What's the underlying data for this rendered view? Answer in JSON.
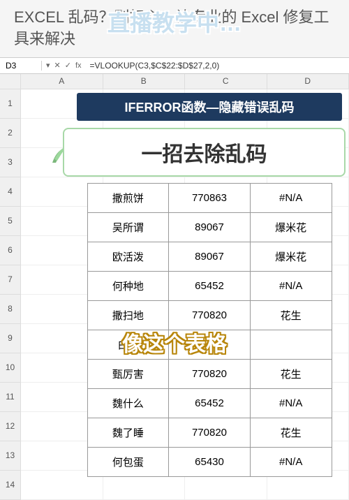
{
  "title": "EXCEL 乱码？别担心，让专业的 Excel 修复工具来解决",
  "overlay_title": "直播教学中…",
  "formula_bar": {
    "cell_ref": "D3",
    "fx_label": "fx",
    "formula": "=VLOOKUP(C3,$C$22:$D$27,2,0)"
  },
  "columns": [
    "A",
    "B",
    "C",
    "D"
  ],
  "row_numbers": [
    "1",
    "2",
    "3",
    "4",
    "5",
    "6",
    "7",
    "8",
    "9",
    "10",
    "11",
    "12",
    "13",
    "14"
  ],
  "banner_text": "IFERROR函数—隐藏错误乱码",
  "sub_banner_text": "一招去除乱码",
  "caption": "像这个表格",
  "table_data": [
    [
      "撒煎饼",
      "770863",
      "#N/A"
    ],
    [
      "吴所谓",
      "89067",
      "爆米花"
    ],
    [
      "欧活泼",
      "89067",
      "爆米花"
    ],
    [
      "何种地",
      "65452",
      "#N/A"
    ],
    [
      "撒扫地",
      "770820",
      "花生"
    ],
    [
      "白读",
      "",
      ""
    ],
    [
      "甄厉害",
      "770820",
      "花生"
    ],
    [
      "魏什么",
      "65452",
      "#N/A"
    ],
    [
      "魏了睡",
      "770820",
      "花生"
    ],
    [
      "何包蛋",
      "65430",
      "#N/A"
    ]
  ]
}
